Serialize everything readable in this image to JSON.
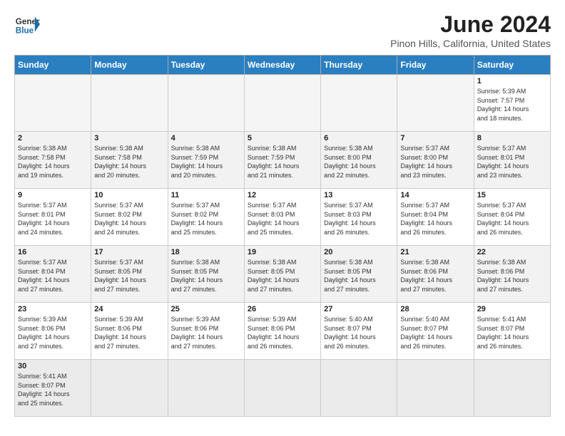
{
  "header": {
    "logo_general": "General",
    "logo_blue": "Blue",
    "month_title": "June 2024",
    "location": "Pinon Hills, California, United States"
  },
  "weekdays": [
    "Sunday",
    "Monday",
    "Tuesday",
    "Wednesday",
    "Thursday",
    "Friday",
    "Saturday"
  ],
  "weeks": [
    [
      {
        "day": "",
        "info": ""
      },
      {
        "day": "",
        "info": ""
      },
      {
        "day": "",
        "info": ""
      },
      {
        "day": "",
        "info": ""
      },
      {
        "day": "",
        "info": ""
      },
      {
        "day": "",
        "info": ""
      },
      {
        "day": "1",
        "info": "Sunrise: 5:39 AM\nSunset: 7:57 PM\nDaylight: 14 hours\nand 18 minutes."
      }
    ],
    [
      {
        "day": "2",
        "info": "Sunrise: 5:38 AM\nSunset: 7:58 PM\nDaylight: 14 hours\nand 19 minutes."
      },
      {
        "day": "3",
        "info": "Sunrise: 5:38 AM\nSunset: 7:58 PM\nDaylight: 14 hours\nand 20 minutes."
      },
      {
        "day": "4",
        "info": "Sunrise: 5:38 AM\nSunset: 7:59 PM\nDaylight: 14 hours\nand 20 minutes."
      },
      {
        "day": "5",
        "info": "Sunrise: 5:38 AM\nSunset: 7:59 PM\nDaylight: 14 hours\nand 21 minutes."
      },
      {
        "day": "6",
        "info": "Sunrise: 5:38 AM\nSunset: 8:00 PM\nDaylight: 14 hours\nand 22 minutes."
      },
      {
        "day": "7",
        "info": "Sunrise: 5:37 AM\nSunset: 8:00 PM\nDaylight: 14 hours\nand 23 minutes."
      },
      {
        "day": "8",
        "info": "Sunrise: 5:37 AM\nSunset: 8:01 PM\nDaylight: 14 hours\nand 23 minutes."
      }
    ],
    [
      {
        "day": "9",
        "info": "Sunrise: 5:37 AM\nSunset: 8:01 PM\nDaylight: 14 hours\nand 24 minutes."
      },
      {
        "day": "10",
        "info": "Sunrise: 5:37 AM\nSunset: 8:02 PM\nDaylight: 14 hours\nand 24 minutes."
      },
      {
        "day": "11",
        "info": "Sunrise: 5:37 AM\nSunset: 8:02 PM\nDaylight: 14 hours\nand 25 minutes."
      },
      {
        "day": "12",
        "info": "Sunrise: 5:37 AM\nSunset: 8:03 PM\nDaylight: 14 hours\nand 25 minutes."
      },
      {
        "day": "13",
        "info": "Sunrise: 5:37 AM\nSunset: 8:03 PM\nDaylight: 14 hours\nand 26 minutes."
      },
      {
        "day": "14",
        "info": "Sunrise: 5:37 AM\nSunset: 8:04 PM\nDaylight: 14 hours\nand 26 minutes."
      },
      {
        "day": "15",
        "info": "Sunrise: 5:37 AM\nSunset: 8:04 PM\nDaylight: 14 hours\nand 26 minutes."
      }
    ],
    [
      {
        "day": "16",
        "info": "Sunrise: 5:37 AM\nSunset: 8:04 PM\nDaylight: 14 hours\nand 27 minutes."
      },
      {
        "day": "17",
        "info": "Sunrise: 5:37 AM\nSunset: 8:05 PM\nDaylight: 14 hours\nand 27 minutes."
      },
      {
        "day": "18",
        "info": "Sunrise: 5:38 AM\nSunset: 8:05 PM\nDaylight: 14 hours\nand 27 minutes."
      },
      {
        "day": "19",
        "info": "Sunrise: 5:38 AM\nSunset: 8:05 PM\nDaylight: 14 hours\nand 27 minutes."
      },
      {
        "day": "20",
        "info": "Sunrise: 5:38 AM\nSunset: 8:05 PM\nDaylight: 14 hours\nand 27 minutes."
      },
      {
        "day": "21",
        "info": "Sunrise: 5:38 AM\nSunset: 8:06 PM\nDaylight: 14 hours\nand 27 minutes."
      },
      {
        "day": "22",
        "info": "Sunrise: 5:38 AM\nSunset: 8:06 PM\nDaylight: 14 hours\nand 27 minutes."
      }
    ],
    [
      {
        "day": "23",
        "info": "Sunrise: 5:39 AM\nSunset: 8:06 PM\nDaylight: 14 hours\nand 27 minutes."
      },
      {
        "day": "24",
        "info": "Sunrise: 5:39 AM\nSunset: 8:06 PM\nDaylight: 14 hours\nand 27 minutes."
      },
      {
        "day": "25",
        "info": "Sunrise: 5:39 AM\nSunset: 8:06 PM\nDaylight: 14 hours\nand 27 minutes."
      },
      {
        "day": "26",
        "info": "Sunrise: 5:39 AM\nSunset: 8:06 PM\nDaylight: 14 hours\nand 26 minutes."
      },
      {
        "day": "27",
        "info": "Sunrise: 5:40 AM\nSunset: 8:07 PM\nDaylight: 14 hours\nand 26 minutes."
      },
      {
        "day": "28",
        "info": "Sunrise: 5:40 AM\nSunset: 8:07 PM\nDaylight: 14 hours\nand 26 minutes."
      },
      {
        "day": "29",
        "info": "Sunrise: 5:41 AM\nSunset: 8:07 PM\nDaylight: 14 hours\nand 26 minutes."
      }
    ],
    [
      {
        "day": "30",
        "info": "Sunrise: 5:41 AM\nSunset: 8:07 PM\nDaylight: 14 hours\nand 25 minutes."
      },
      {
        "day": "",
        "info": ""
      },
      {
        "day": "",
        "info": ""
      },
      {
        "day": "",
        "info": ""
      },
      {
        "day": "",
        "info": ""
      },
      {
        "day": "",
        "info": ""
      },
      {
        "day": "",
        "info": ""
      }
    ]
  ]
}
